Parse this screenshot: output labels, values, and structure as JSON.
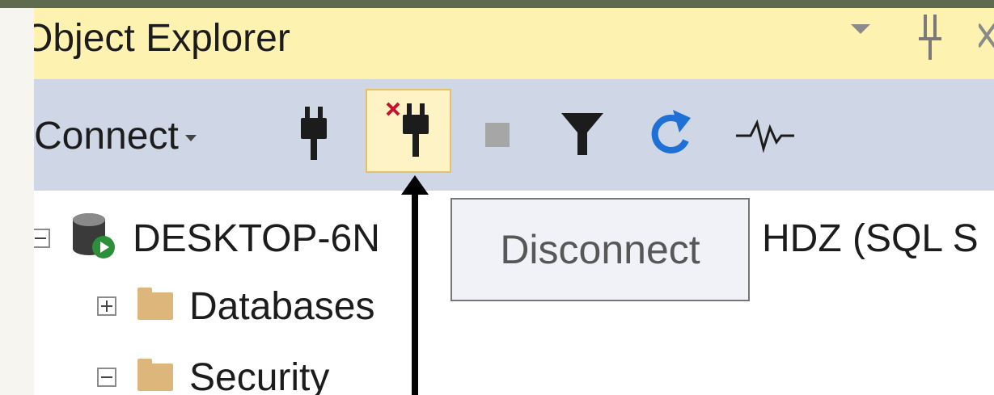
{
  "window": {
    "title": "Object Explorer",
    "title_controls": [
      {
        "name": "window-position-icon",
        "glyph": "▾"
      },
      {
        "name": "auto-hide-pin-icon",
        "glyph": "⁑"
      }
    ]
  },
  "toolbar": {
    "connect_label": "Connect",
    "buttons": [
      {
        "name": "connect-icon",
        "state": "normal"
      },
      {
        "name": "disconnect-icon",
        "state": "hovered"
      },
      {
        "name": "stop-icon",
        "state": "disabled"
      },
      {
        "name": "filter-icon",
        "state": "normal"
      },
      {
        "name": "refresh-icon",
        "state": "normal"
      },
      {
        "name": "activity-monitor-icon",
        "state": "normal"
      }
    ]
  },
  "tree": {
    "server": {
      "label_left": "DESKTOP-6N",
      "label_right": "HDZ (SQL S",
      "expanded": true
    },
    "children": [
      {
        "label": "Databases",
        "expanded": false
      },
      {
        "label": "Security",
        "expanded": true
      }
    ]
  },
  "tooltip": {
    "text": "Disconnect"
  },
  "colors": {
    "title_bar": "#fef2b0",
    "toolbar": "#cfd6e5",
    "hover_highlight": "#fdf3c4",
    "hover_border": "#e5c365",
    "refresh_blue": "#1e6fd6",
    "disconnect_red": "#c8102e",
    "window_border": "#5e6b4e"
  }
}
